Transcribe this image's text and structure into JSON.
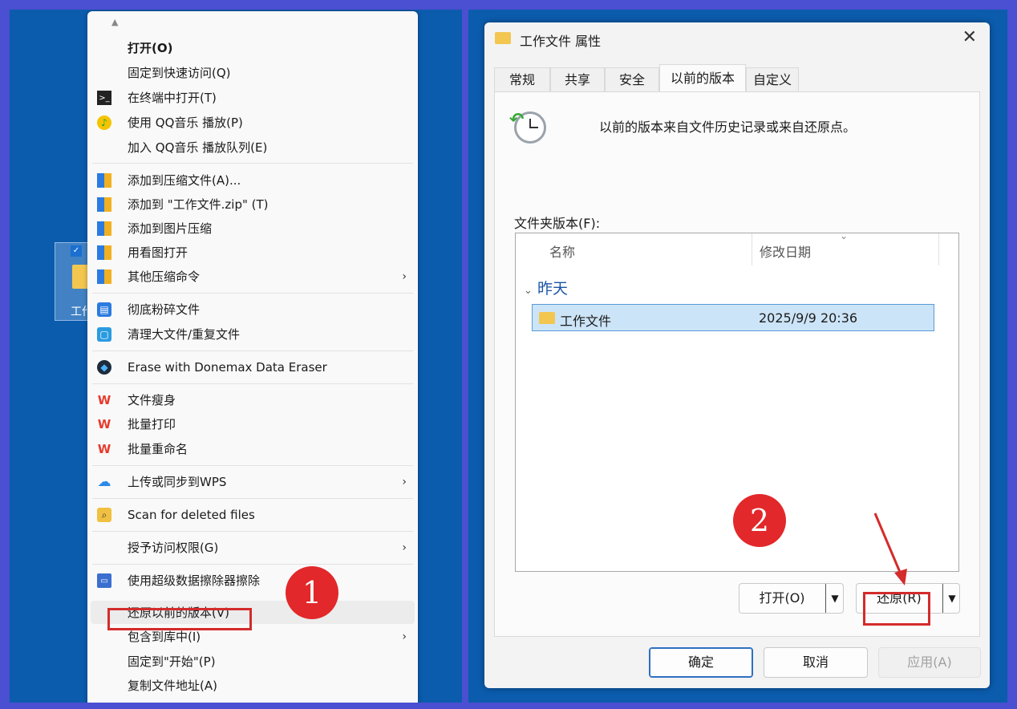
{
  "desktop": {
    "icon_label": "工作"
  },
  "context_menu": {
    "items": [
      {
        "label": "打开(O)",
        "icon": "none"
      },
      {
        "label": "固定到快速访问(Q)",
        "icon": "none"
      },
      {
        "label": "在终端中打开(T)",
        "icon": "terminal-icon"
      },
      {
        "label": "使用 QQ音乐 播放(P)",
        "icon": "qq-music-icon"
      },
      {
        "label": "加入 QQ音乐 播放队列(E)",
        "icon": "none"
      },
      {
        "label": "添加到压缩文件(A)...",
        "icon": "archive-icon"
      },
      {
        "label": "添加到 \"工作文件.zip\" (T)",
        "icon": "archive-icon"
      },
      {
        "label": "添加到图片压缩",
        "icon": "archive-icon"
      },
      {
        "label": "用看图打开",
        "icon": "archive-icon"
      },
      {
        "label": "其他压缩命令",
        "icon": "archive-icon"
      },
      {
        "label": "彻底粉碎文件",
        "icon": "shredder-icon"
      },
      {
        "label": "清理大文件/重复文件",
        "icon": "cleaner-icon"
      },
      {
        "label": "Erase with Donemax Data Eraser",
        "icon": "donemax-icon"
      },
      {
        "label": "文件瘦身",
        "icon": "wps-icon"
      },
      {
        "label": "批量打印",
        "icon": "wps-icon"
      },
      {
        "label": "批量重命名",
        "icon": "wps-icon"
      },
      {
        "label": "上传或同步到WPS",
        "icon": "cloud-icon"
      },
      {
        "label": "Scan for deleted files",
        "icon": "scan-icon"
      },
      {
        "label": "授予访问权限(G)",
        "icon": "none"
      },
      {
        "label": "使用超级数据擦除器擦除",
        "icon": "monitor-icon"
      },
      {
        "label": "还原以前的版本(V)",
        "icon": "none"
      },
      {
        "label": "包含到库中(I)",
        "icon": "none"
      },
      {
        "label": "固定到\"开始\"(P)",
        "icon": "none"
      },
      {
        "label": "复制文件地址(A)",
        "icon": "none"
      }
    ]
  },
  "annotations": {
    "step1": "1",
    "step2": "2"
  },
  "dialog": {
    "title": "工作文件 属性",
    "tabs": [
      "常规",
      "共享",
      "安全",
      "以前的版本",
      "自定义"
    ],
    "active_tab": "以前的版本",
    "info_text": "以前的版本来自文件历史记录或来自还原点。",
    "folder_versions_label": "文件夹版本(F):",
    "columns": [
      "名称",
      "修改日期"
    ],
    "group": "昨天",
    "rows": [
      {
        "name": "工作文件",
        "date": "2025/9/9 20:36"
      }
    ],
    "open_button": "打开(O)",
    "restore_button": "还原(R)",
    "ok_button": "确定",
    "cancel_button": "取消",
    "apply_button": "应用(A)"
  },
  "colors": {
    "desktop_bg": "#0b5cad",
    "frame": "#4b4fd1",
    "annotation_red": "#e2282a"
  }
}
